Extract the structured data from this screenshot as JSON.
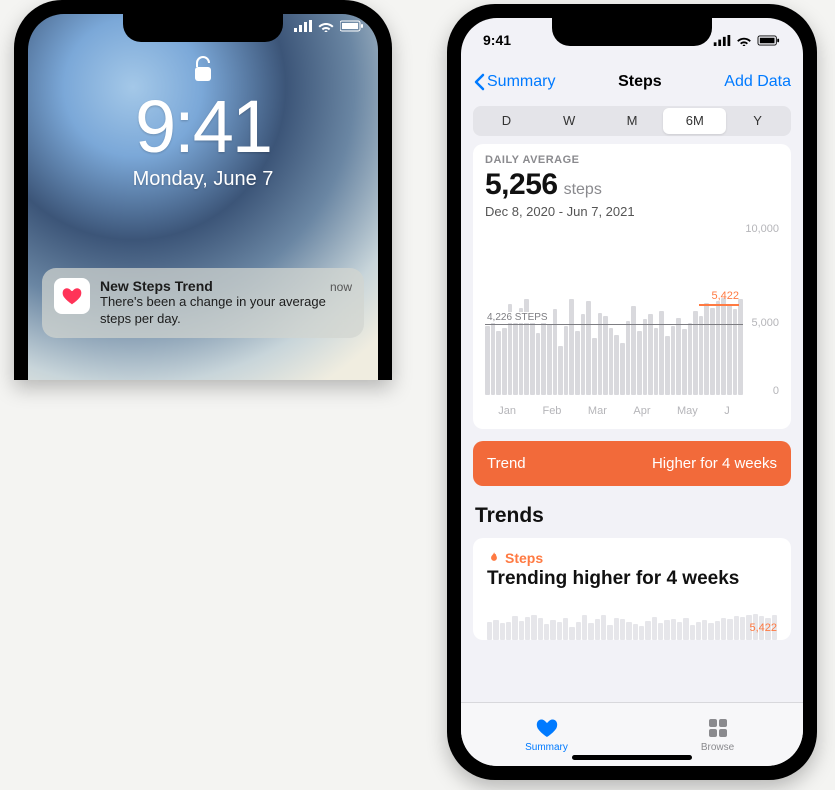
{
  "lock_screen": {
    "time": "9:41",
    "date": "Monday, June 7",
    "notification": {
      "title": "New Steps Trend",
      "body": "There's been a change in your average steps per day.",
      "time": "now"
    }
  },
  "health_screen": {
    "status_time": "9:41",
    "back_label": "Summary",
    "title": "Steps",
    "add_label": "Add Data",
    "segments": [
      "D",
      "W",
      "M",
      "6M",
      "Y"
    ],
    "active_segment": "6M",
    "kicker": "DAILY AVERAGE",
    "metric_value": "5,256",
    "metric_unit": "steps",
    "date_range": "Dec 8, 2020 - Jun 7, 2021",
    "avg_value": "4,226",
    "avg_full_label": "4,226 STEPS",
    "recent_avg_value": "5,422",
    "trend_label": "Trend",
    "trend_value": "Higher for 4 weeks",
    "section_title": "Trends",
    "trend_card": {
      "label": "Steps",
      "headline": "Trending higher for 4 weeks",
      "recent_label": "5,422"
    },
    "tabs": {
      "summary": "Summary",
      "browse": "Browse"
    }
  },
  "chart_data": {
    "type": "bar",
    "title": "Daily Average Steps",
    "xlabel": "",
    "ylabel": "Steps",
    "ylim": [
      0,
      10000
    ],
    "yticks": [
      0,
      5000,
      10000
    ],
    "period_average": 4226,
    "recent_4wk_average": 5422,
    "month_labels": [
      "Jan",
      "Feb",
      "Mar",
      "Apr",
      "May",
      "J"
    ],
    "values": [
      4100,
      4600,
      3800,
      4000,
      5400,
      4300,
      5200,
      5700,
      4900,
      3700,
      4500,
      4200,
      5100,
      2900,
      4100,
      5700,
      3800,
      4800,
      5600,
      3400,
      4900,
      4700,
      4000,
      3600,
      3100,
      4400,
      5300,
      3800,
      4500,
      4800,
      4000,
      5000,
      3500,
      4100,
      4600,
      3900,
      4300,
      5000,
      4700,
      5500,
      5200,
      5600,
      5800,
      5400,
      5100,
      5700
    ]
  }
}
